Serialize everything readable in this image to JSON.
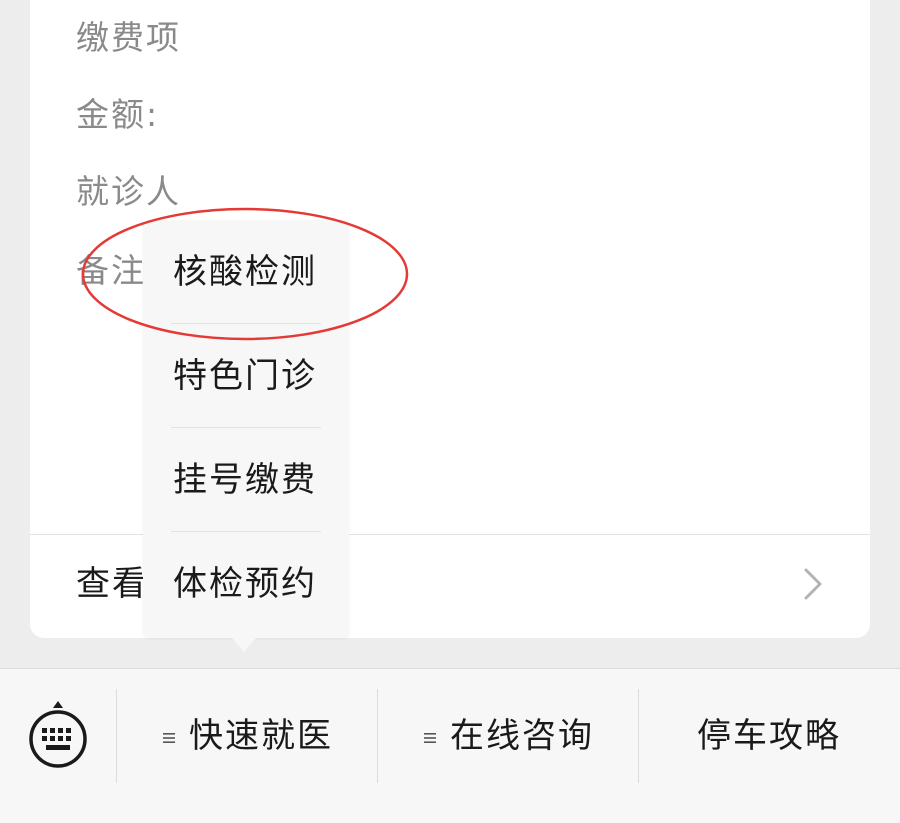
{
  "card": {
    "fields": [
      "缴费项",
      "金额:",
      "就诊人",
      "备注"
    ],
    "view_more": "查看"
  },
  "popup": {
    "items": [
      "核酸检测",
      "特色门诊",
      "挂号缴费",
      "体检预约"
    ]
  },
  "bottom_bar": {
    "menus": [
      "快速就医",
      "在线咨询",
      "停车攻略"
    ]
  },
  "colors": {
    "annotation": "#e53935",
    "background": "#ededed"
  }
}
